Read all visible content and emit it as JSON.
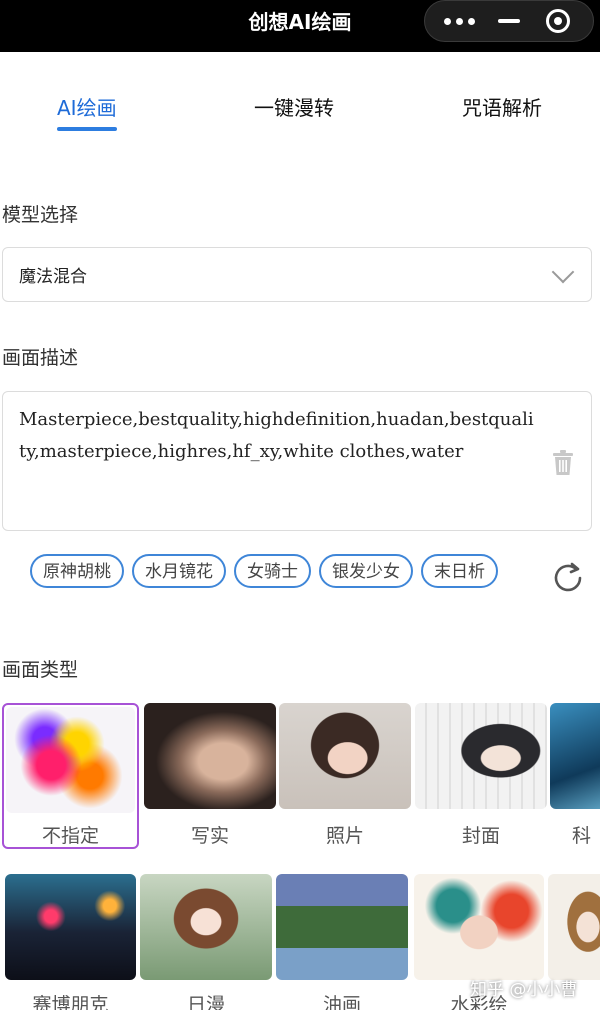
{
  "window": {
    "title": "创想AI绘画",
    "capsule_icons": [
      "more-dots-icon",
      "minimize-icon",
      "close-target-icon"
    ]
  },
  "tabs": [
    {
      "label": "AI绘画",
      "active": true
    },
    {
      "label": "一键漫转",
      "active": false
    },
    {
      "label": "咒语解析",
      "active": false
    }
  ],
  "model": {
    "section_label": "模型选择",
    "selected": "魔法混合"
  },
  "description": {
    "section_label": "画面描述",
    "value": "Masterpiece,bestquality,highdefinition,huadan,bestquality,masterpiece,highres,hf_xy,white clothes,water"
  },
  "tags": [
    "原神胡桃",
    "水月镜花",
    "女骑士",
    "银发少女",
    "末日析"
  ],
  "style_type": {
    "section_label": "画面类型",
    "row1": [
      {
        "label": "不指定",
        "selected": true
      },
      {
        "label": "写实",
        "selected": false
      },
      {
        "label": "照片",
        "selected": false
      },
      {
        "label": "封面",
        "selected": false
      },
      {
        "label": "科",
        "selected": false
      }
    ],
    "row2": [
      {
        "label": "赛博朋克"
      },
      {
        "label": "日漫"
      },
      {
        "label": "油画"
      },
      {
        "label": "水彩绘"
      },
      {
        "label": ""
      }
    ]
  },
  "watermark": "知乎 @小小曹",
  "colors": {
    "accent": "#1e6bd8",
    "chip_border": "#3f86d8",
    "selected_border": "#a752d6",
    "titlebar": "#000000"
  }
}
